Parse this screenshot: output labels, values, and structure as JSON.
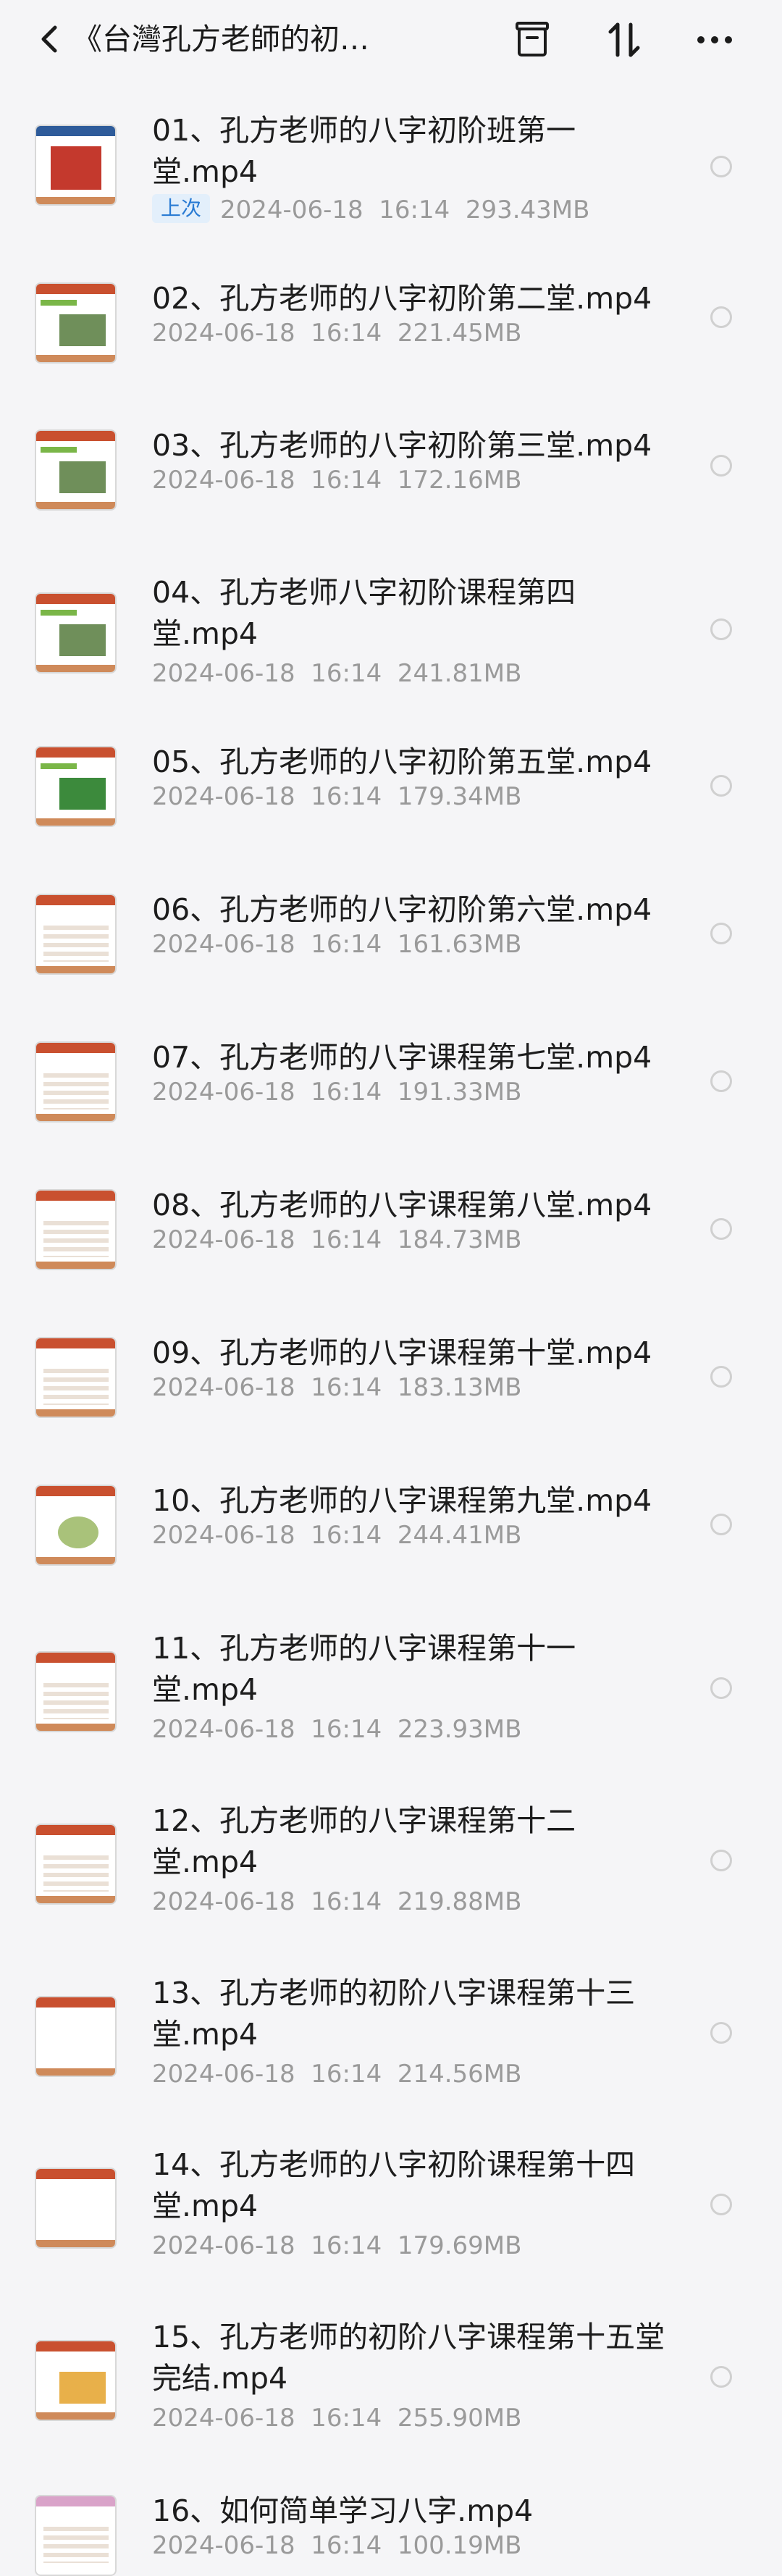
{
  "header": {
    "title": "《台灣孔方老師的初…",
    "back_icon": "chevron-left-icon",
    "actions": [
      "folder-box-icon",
      "sort-arrows-icon",
      "more-dots-icon"
    ]
  },
  "files": [
    {
      "name": "01、孔方老师的八字初阶班第一堂.mp4",
      "badge": "上次",
      "date": "2024-06-18",
      "time": "16:14",
      "size": "293.43MB"
    },
    {
      "name": "02、孔方老师的八字初阶第二堂.mp4",
      "date": "2024-06-18",
      "time": "16:14",
      "size": "221.45MB"
    },
    {
      "name": "03、孔方老师的八字初阶第三堂.mp4",
      "date": "2024-06-18",
      "time": "16:14",
      "size": "172.16MB"
    },
    {
      "name": "04、孔方老师八字初阶课程第四堂.mp4",
      "date": "2024-06-18",
      "time": "16:14",
      "size": "241.81MB"
    },
    {
      "name": "05、孔方老师的八字初阶第五堂.mp4",
      "date": "2024-06-18",
      "time": "16:14",
      "size": "179.34MB"
    },
    {
      "name": "06、孔方老师的八字初阶第六堂.mp4",
      "date": "2024-06-18",
      "time": "16:14",
      "size": "161.63MB"
    },
    {
      "name": "07、孔方老师的八字课程第七堂.mp4",
      "date": "2024-06-18",
      "time": "16:14",
      "size": "191.33MB"
    },
    {
      "name": "08、孔方老师的八字课程第八堂.mp4",
      "date": "2024-06-18",
      "time": "16:14",
      "size": "184.73MB"
    },
    {
      "name": "09、孔方老师的八字课程第十堂.mp4",
      "date": "2024-06-18",
      "time": "16:14",
      "size": "183.13MB"
    },
    {
      "name": "10、孔方老师的八字课程第九堂.mp4",
      "date": "2024-06-18",
      "time": "16:14",
      "size": "244.41MB"
    },
    {
      "name": "11、孔方老师的八字课程第十一堂.mp4",
      "date": "2024-06-18",
      "time": "16:14",
      "size": "223.93MB"
    },
    {
      "name": "12、孔方老师的八字课程第十二堂.mp4",
      "date": "2024-06-18",
      "time": "16:14",
      "size": "219.88MB"
    },
    {
      "name": "13、孔方老师的初阶八字课程第十三堂.mp4",
      "date": "2024-06-18",
      "time": "16:14",
      "size": "214.56MB"
    },
    {
      "name": "14、孔方老师的八字初阶课程第十四堂.mp4",
      "date": "2024-06-18",
      "time": "16:14",
      "size": "179.69MB"
    },
    {
      "name": "15、孔方老师的初阶八字课程第十五堂完结.mp4",
      "date": "2024-06-18",
      "time": "16:14",
      "size": "255.90MB"
    },
    {
      "name": "16、如何简单学习八字.mp4",
      "date": "2024-06-18",
      "time": "16:14",
      "size": "100.19MB"
    }
  ]
}
